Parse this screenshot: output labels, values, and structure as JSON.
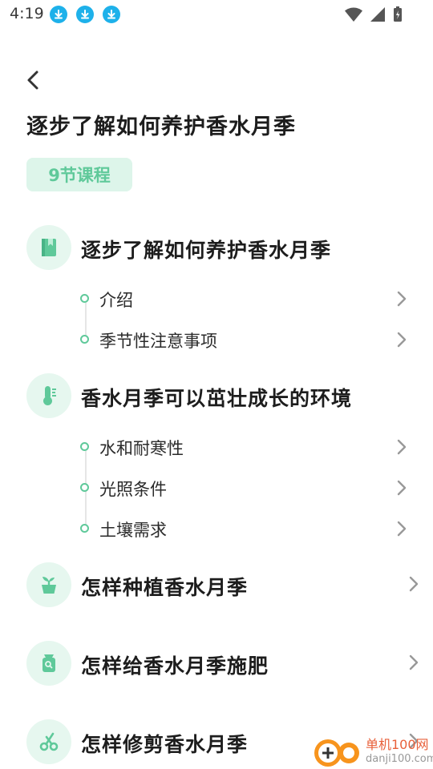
{
  "status_bar": {
    "time": "4:19"
  },
  "page": {
    "title": "逐步了解如何养护香水月季",
    "badge": "9节课程"
  },
  "sections": [
    {
      "title": "逐步了解如何养护香水月季",
      "icon": "book-icon",
      "lessons": [
        "介绍",
        "季节性注意事项"
      ]
    },
    {
      "title": "香水月季可以茁壮成长的环境",
      "icon": "thermometer-icon",
      "lessons": [
        "水和耐寒性",
        "光照条件",
        "土壤需求"
      ]
    },
    {
      "title": "怎样种植香水月季",
      "icon": "sprout-pot-icon",
      "lessons": []
    },
    {
      "title": "怎样给香水月季施肥",
      "icon": "fertilizer-bag-icon",
      "lessons": []
    },
    {
      "title": "怎样修剪香水月季",
      "icon": "scissors-icon",
      "lessons": []
    }
  ],
  "watermark": {
    "brand": "单机100网",
    "url": "danji100.com"
  },
  "colors": {
    "accent": "#5fc99a",
    "badge_bg": "#ddf5ea",
    "icon_bg": "#e6f7ef",
    "download_badge": "#1eb1ea"
  }
}
